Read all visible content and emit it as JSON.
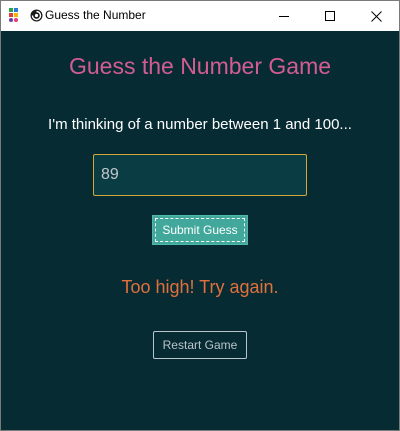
{
  "window": {
    "title": "Guess the Number"
  },
  "icons": {
    "app_logo": "app-logo-icon",
    "title_icon": "swirl-icon",
    "minimize": "minimize-icon",
    "maximize": "maximize-icon",
    "close": "close-icon"
  },
  "game": {
    "title": "Guess the Number Game",
    "prompt": "I'm thinking of a number between 1 and 100...",
    "guess_value": "89",
    "submit_label": "Submit Guess",
    "feedback": "Too high! Try again.",
    "restart_label": "Restart Game"
  },
  "colors": {
    "background": "#072b33",
    "title": "#d35d92",
    "prompt": "#ffffff",
    "input_border": "#d4a53a",
    "input_background": "#0a3c44",
    "submit_background": "#42a89c",
    "feedback": "#e0703c",
    "restart_border": "#b8c4c8"
  }
}
